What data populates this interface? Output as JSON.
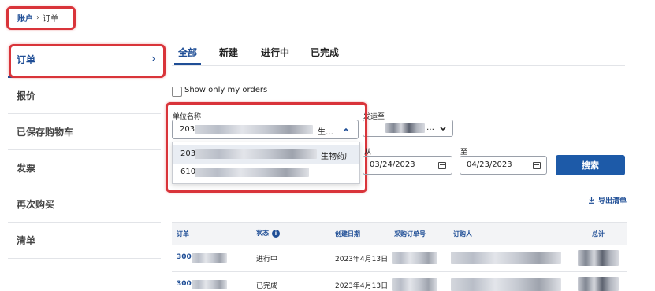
{
  "breadcrumb": {
    "parent": "账户",
    "separator": "›",
    "current": "订单"
  },
  "sidebar": {
    "items": [
      {
        "label": "订单",
        "active": true
      },
      {
        "label": "报价"
      },
      {
        "label": "已保存购物车"
      },
      {
        "label": "发票"
      },
      {
        "label": "再次购买"
      },
      {
        "label": "清单"
      }
    ],
    "chevron": "›"
  },
  "tabs": [
    {
      "label": "全部",
      "active": true
    },
    {
      "label": "新建"
    },
    {
      "label": "进行中"
    },
    {
      "label": "已完成"
    }
  ],
  "filters": {
    "show_only_mine_label": "Show only my orders",
    "unit_name_label": "单位名称",
    "unit_name_value_prefix": "203",
    "unit_name_value_suffix": "生…",
    "ship_to_label": "发运至",
    "from_label": "从",
    "from_date": "03/24/2023",
    "to_label": "至",
    "to_date": "04/23/2023",
    "search_button": "搜索",
    "dropdown_options": [
      {
        "prefix": "203",
        "suffix": "生物药厂"
      },
      {
        "prefix": "610",
        "suffix": ""
      }
    ]
  },
  "export_label": "导出清单",
  "table": {
    "headers": [
      "订单",
      "状态",
      "创建日期",
      "采购订单号",
      "订购人",
      "总计"
    ],
    "status_info_icon": "i",
    "rows": [
      {
        "order_prefix": "300",
        "status": "进行中",
        "created": "2023年4月13日"
      },
      {
        "order_prefix": "300",
        "status": "已完成",
        "created": "2023年4月13日"
      }
    ]
  },
  "colors": {
    "accent": "#1f4e96",
    "button": "#1d5aa8",
    "highlight_box": "#d9343a"
  }
}
